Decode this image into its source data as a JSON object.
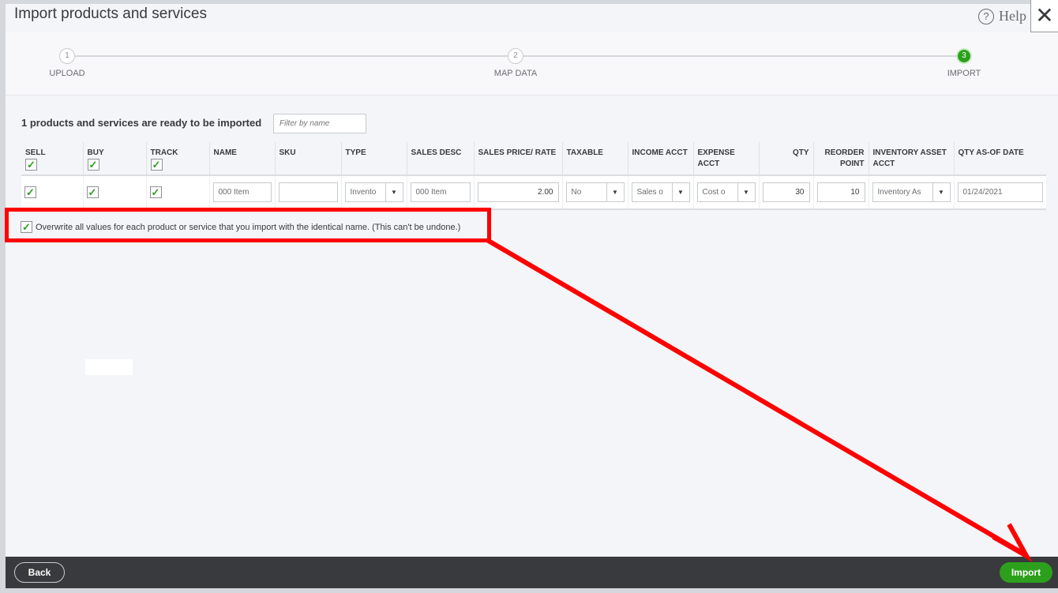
{
  "title": "Import products and services",
  "help_label": "Help",
  "close_label": "✕",
  "steps": [
    {
      "num": "1",
      "label": "UPLOAD"
    },
    {
      "num": "2",
      "label": "MAP DATA"
    },
    {
      "num": "3",
      "label": "IMPORT",
      "active": true
    }
  ],
  "heading": "1 products and services are ready to be imported",
  "filter_placeholder": "Filter by name",
  "columns": [
    "SELL",
    "BUY",
    "TRACK",
    "NAME",
    "SKU",
    "TYPE",
    "SALES DESC",
    "SALES PRICE/ RATE",
    "TAXABLE",
    "INCOME ACCT",
    "EXPENSE ACCT",
    "QTY",
    "REORDER POINT",
    "INVENTORY ASSET ACCT",
    "QTY AS-OF DATE"
  ],
  "header_checks": {
    "sell": true,
    "buy": true,
    "track": true
  },
  "row": {
    "sell": true,
    "buy": true,
    "track": true,
    "name": "000 Item",
    "sku": "",
    "type": "Invento",
    "sales_desc": "000 Item",
    "sales_price": "2.00",
    "taxable": "No",
    "income_acct": "Sales o",
    "expense_acct": "Cost o",
    "qty": "30",
    "reorder_point": "10",
    "inventory_asset_acct": "Inventory As",
    "qty_as_of_date": "01/24/2021"
  },
  "overwrite": {
    "checked": true,
    "label": "Overwrite all values for each product or service that you import with the identical name. (This can't be undone.)"
  },
  "footer": {
    "back": "Back",
    "import": "Import"
  },
  "colors": {
    "accent": "#2ca01c",
    "annotation": "#ff0000",
    "footer": "#393a3d"
  }
}
